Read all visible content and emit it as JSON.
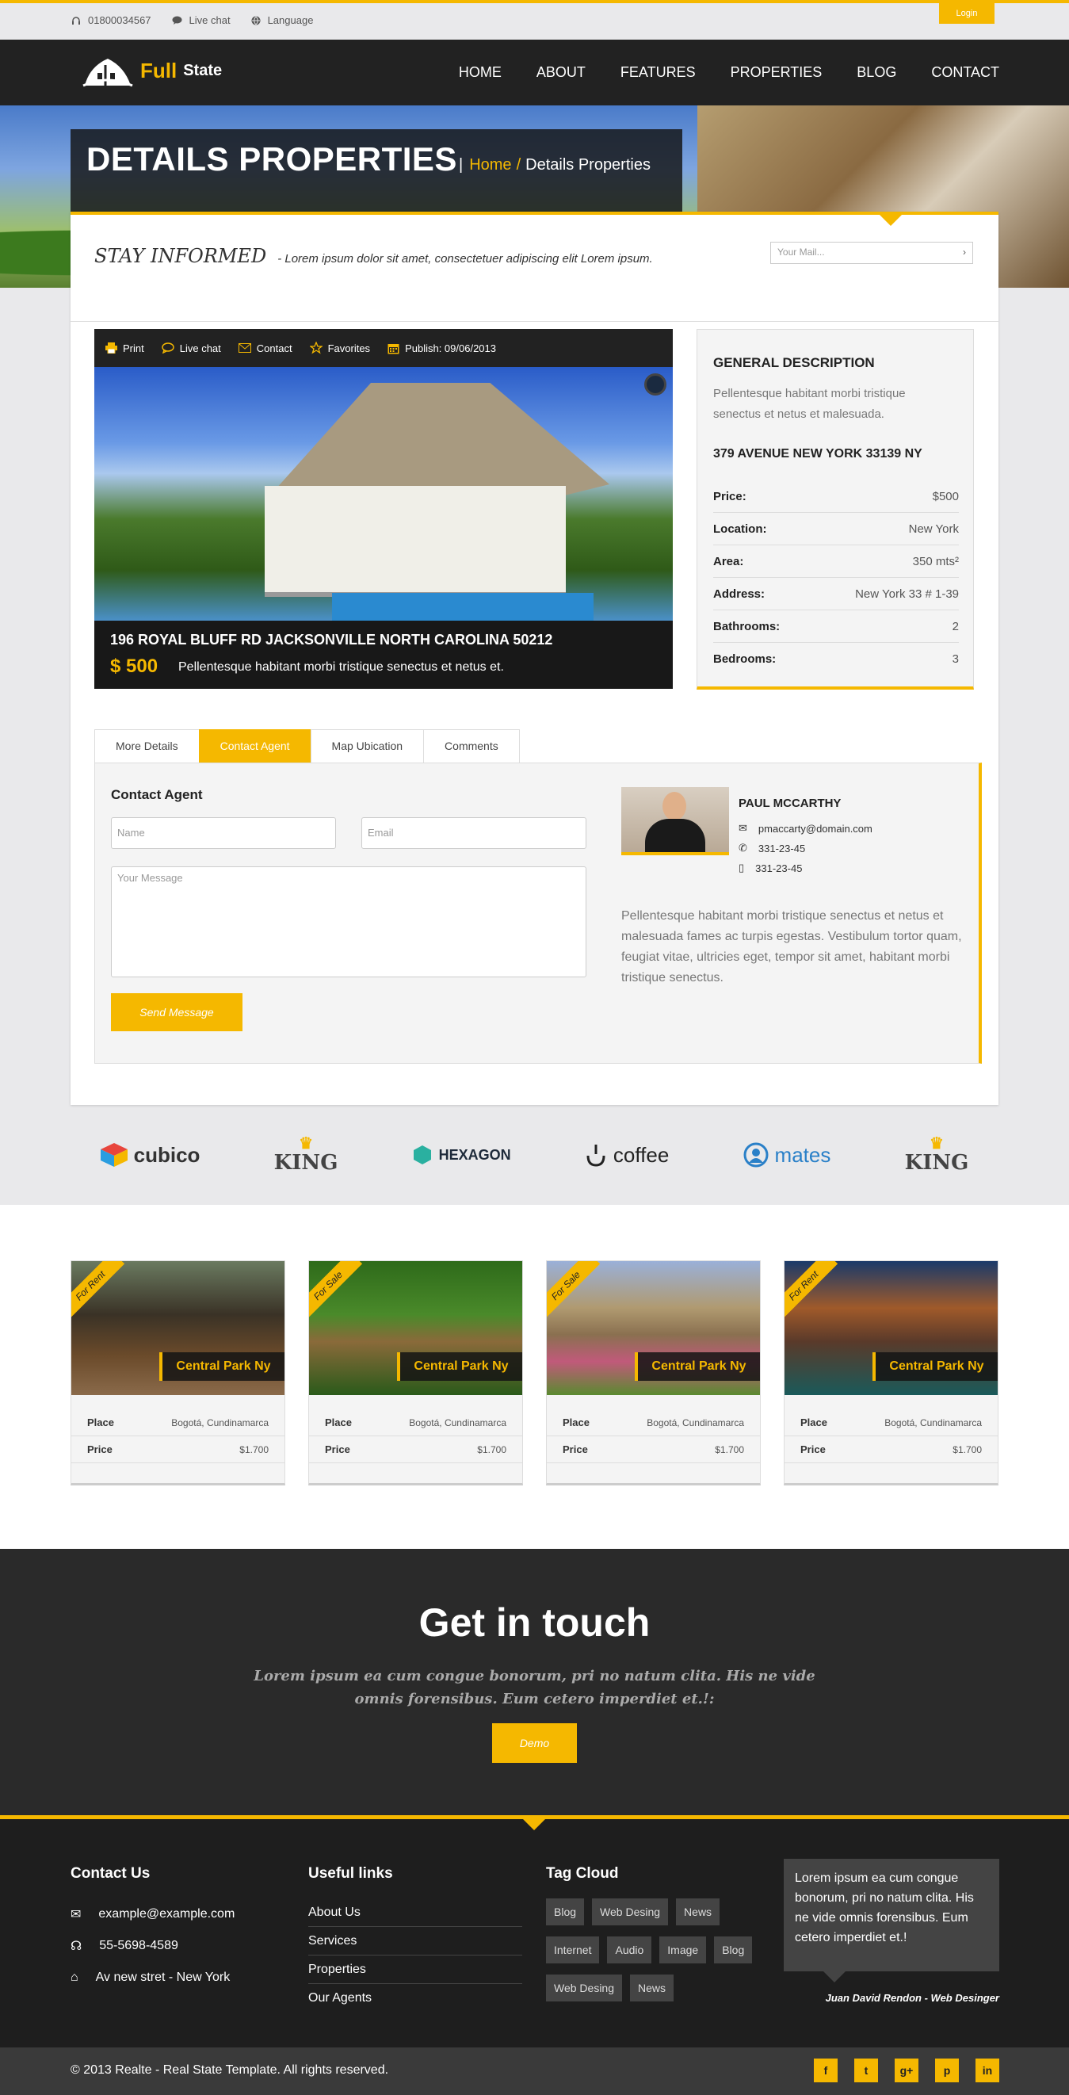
{
  "topbar": {
    "phone": "01800034567",
    "chat": "Live chat",
    "language": "Language",
    "login": "Login"
  },
  "nav": {
    "logo_full": "Full",
    "logo_state": "State",
    "items": [
      "HOME",
      "ABOUT",
      "FEATURES",
      "PROPERTIES",
      "BLOG",
      "CONTACT"
    ]
  },
  "hero": {
    "title": "DETAILS PROPERTIES",
    "breadcrumb_home": "Home",
    "breadcrumb_sep": "/",
    "breadcrumb_current": "Details Properties"
  },
  "stay": {
    "title": "STAY INFORMED",
    "text": "- Lorem ipsum dolor sit amet, consectetuer adipiscing elit Lorem ipsum.",
    "mail_placeholder": "Your Mail..."
  },
  "photo_tools": [
    "Print",
    "Live chat",
    "Contact",
    "Favorites",
    "Publish: 09/06/2013"
  ],
  "property": {
    "address": "196 ROYAL BLUFF RD JACKSONVILLE NORTH CAROLINA 50212",
    "price": "$ 500",
    "desc": "Pellentesque habitant morbi tristique senectus et netus et."
  },
  "general": {
    "title": "GENERAL DESCRIPTION",
    "lead": "Pellentesque habitant morbi tristique senectus et netus et malesuada.",
    "street": "379 AVENUE NEW YORK 33139 NY",
    "rows": [
      {
        "k": "Price:",
        "v": "$500"
      },
      {
        "k": "Location:",
        "v": "New York"
      },
      {
        "k": "Area:",
        "v": "350 mts²"
      },
      {
        "k": "Address:",
        "v": "New York 33 # 1-39"
      },
      {
        "k": "Bathrooms:",
        "v": "2"
      },
      {
        "k": "Bedrooms:",
        "v": "3"
      }
    ]
  },
  "tabs": [
    "More Details",
    "Contact Agent",
    "Map Ubication",
    "Comments"
  ],
  "contact": {
    "title": "Contact Agent",
    "name_ph": "Name",
    "email_ph": "Email",
    "message_ph": "Your Message",
    "send": "Send Message"
  },
  "agent": {
    "name": "PAUL MCCARTHY",
    "email": "pmaccarty@domain.com",
    "phone1": "331-23-45",
    "phone2": "331-23-45",
    "bio": "Pellentesque habitant morbi tristique senectus et netus et malesuada fames ac turpis egestas. Vestibulum tortor quam, feugiat vitae, ultricies eget, tempor sit amet, habitant morbi tristique senectus."
  },
  "brands": [
    "cubico",
    "KING",
    "HEXAGON",
    "coffee",
    "mates",
    "KING"
  ],
  "listings": [
    {
      "ribbon": "For Rent",
      "label": "Central Park Ny",
      "place_k": "Place",
      "place_v": "Bogotá, Cundinamarca",
      "price_k": "Price",
      "price_v": "$1.700"
    },
    {
      "ribbon": "For Sale",
      "label": "Central Park Ny",
      "place_k": "Place",
      "place_v": "Bogotá, Cundinamarca",
      "price_k": "Price",
      "price_v": "$1.700"
    },
    {
      "ribbon": "For Sale",
      "label": "Central Park Ny",
      "place_k": "Place",
      "place_v": "Bogotá, Cundinamarca",
      "price_k": "Price",
      "price_v": "$1.700"
    },
    {
      "ribbon": "For Rent",
      "label": "Central Park Ny",
      "place_k": "Place",
      "place_v": "Bogotá, Cundinamarca",
      "price_k": "Price",
      "price_v": "$1.700"
    }
  ],
  "touch": {
    "title": "Get in touch",
    "text": "Lorem ipsum ea cum congue bonorum, pri no natum clita. His ne vide omnis forensibus. Eum cetero imperdiet et.!:",
    "button": "Demo"
  },
  "footer": {
    "contact_title": "Contact Us",
    "email": "example@example.com",
    "phone": "55-5698-4589",
    "address": "Av new stret - New York",
    "links_title": "Useful links",
    "links": [
      "About Us",
      "Services",
      "Properties",
      "Our Agents"
    ],
    "tags_title": "Tag Cloud",
    "tags": [
      "Blog",
      "Web Desing",
      "News",
      "Internet",
      "Audio",
      "Image",
      "Blog",
      "Web Desing",
      "News"
    ],
    "quote": "Lorem ipsum ea cum congue bonorum, pri no natum clita. His ne vide omnis forensibus. Eum cetero imperdiet et.!",
    "author": "Juan David Rendon - Web Desinger",
    "copyright": "© 2013 Realte - Real State Template. All rights reserved.",
    "socials": [
      "f",
      "t",
      "g+",
      "p",
      "in"
    ]
  },
  "colors": {
    "accent": "#f5b800",
    "dark": "#222222"
  }
}
